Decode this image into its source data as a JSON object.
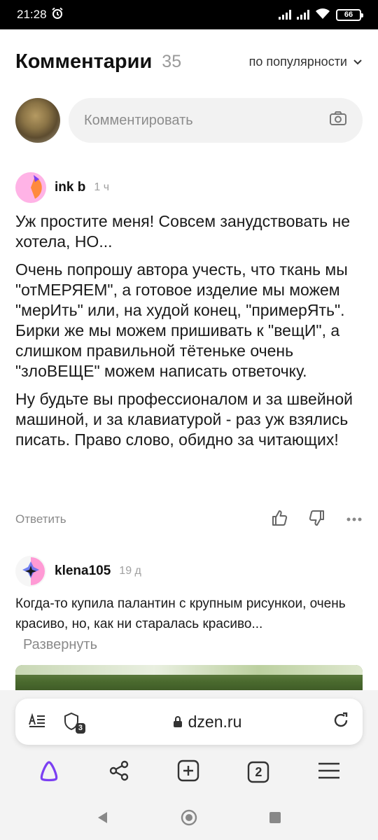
{
  "status": {
    "time": "21:28",
    "battery": "66"
  },
  "header": {
    "title": "Комментарии",
    "count": "35",
    "sort_label": "по популярности"
  },
  "comment_input": {
    "placeholder": "Комментировать"
  },
  "comments": [
    {
      "author": "ink b",
      "time": "1 ч",
      "paragraphs": [
        "Уж простите меня! Совсем занудствовать не хотела, НО...",
        "Очень попрошу автора учесть, что ткань мы \"отМЕРЯЕМ\", а готовое изделие мы можем \"мерИть\" или, на худой конец, \"примерЯть\". Бирки же мы можем пришивать к \"вещИ\", а слишком правильной тётеньке очень \"злоВЕЩЕ\" можем написать ответочку.",
        "Ну будьте вы профессионалом и за швейной машиной, и за клавиатурой - раз уж взялись писать. Право слово, обидно за читающих!"
      ],
      "reply_label": "Ответить"
    },
    {
      "author": "klena105",
      "time": "19 д",
      "text": "Когда-то купила палантин с крупным рисункои, очень красиво, но, как ни старалась красиво...",
      "expand_label": "Развернуть"
    }
  ],
  "browser": {
    "url": "dzen.ru",
    "shield_badge": "3",
    "tabs_count": "2"
  },
  "colors": {
    "accent_purple": "#7b3ff2",
    "avatar1_pink": "#ffb3e6",
    "avatar1_orange": "#ff8a3d",
    "avatar2_pink": "#ff9ad5",
    "avatar2_blue": "#5b6cf0"
  }
}
